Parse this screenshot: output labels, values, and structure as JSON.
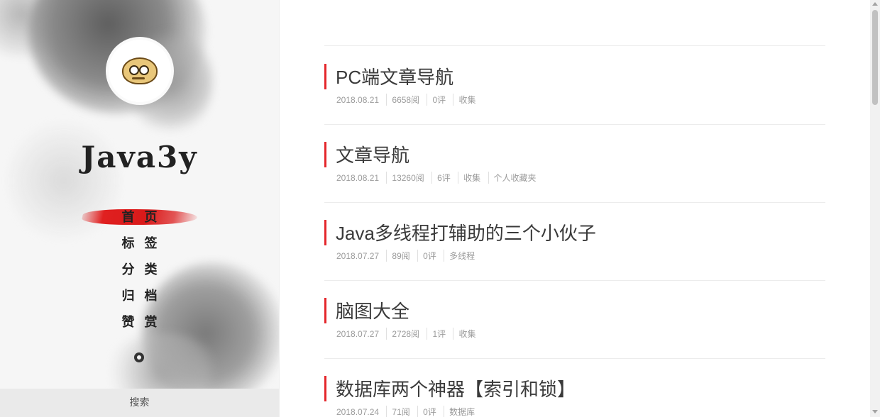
{
  "sidebar": {
    "site_title": "Java3y",
    "nav": [
      {
        "label": "首页",
        "active": true
      },
      {
        "label": "标签",
        "active": false
      },
      {
        "label": "分类",
        "active": false
      },
      {
        "label": "归档",
        "active": false
      },
      {
        "label": "赞赏",
        "active": false
      }
    ],
    "github_icon": "github-icon",
    "search_label": "搜索"
  },
  "posts": [
    {
      "title": "PC端文章导航",
      "date": "2018.08.21",
      "views": "6658阅",
      "comments": "0评",
      "tags": [
        "收集"
      ]
    },
    {
      "title": "文章导航",
      "date": "2018.08.21",
      "views": "13260阅",
      "comments": "6评",
      "tags": [
        "收集",
        "个人收藏夹"
      ]
    },
    {
      "title": "Java多线程打辅助的三个小伙子",
      "date": "2018.07.27",
      "views": "89阅",
      "comments": "0评",
      "tags": [
        "多线程"
      ]
    },
    {
      "title": "脑图大全",
      "date": "2018.07.27",
      "views": "2728阅",
      "comments": "1评",
      "tags": [
        "收集"
      ]
    },
    {
      "title": "数据库两个神器【索引和锁】",
      "date": "2018.07.24",
      "views": "71阅",
      "comments": "0评",
      "tags": [
        "数据库"
      ]
    }
  ],
  "colors": {
    "accent": "#e4262b",
    "sidebar_bg": "#f6f6f6",
    "text": "#3a3a3a",
    "meta": "#9b9b9b"
  }
}
